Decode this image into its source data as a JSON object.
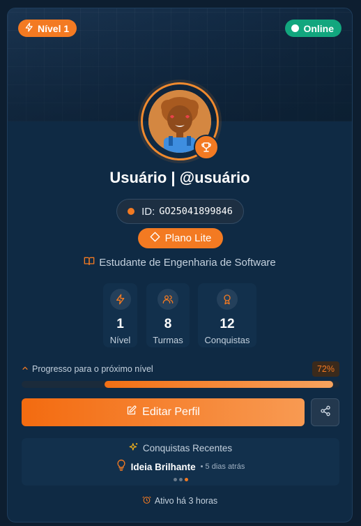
{
  "badges": {
    "level": "Nível 1",
    "status": "Online"
  },
  "profile": {
    "name": "Usuário | @usuário",
    "id_label": "ID:",
    "id_value": "GO25041899846",
    "plan": "Plano Lite",
    "course": "Estudante de Engenharia de Software"
  },
  "stats": [
    {
      "value": "1",
      "label": "Nível"
    },
    {
      "value": "8",
      "label": "Turmas"
    },
    {
      "value": "12",
      "label": "Conquistas"
    }
  ],
  "progress": {
    "label": "Progresso para o próximo nível",
    "percent_text": "72%",
    "percent": 72
  },
  "actions": {
    "edit_label": "Editar Perfil"
  },
  "recent": {
    "title": "Conquistas Recentes",
    "item_name": "Ideia Brilhante",
    "item_time": "• 5 dias atrás"
  },
  "activity": "Ativo há 3 horas",
  "colors": {
    "accent": "#f37a22",
    "online": "#12a67e",
    "card": "#0f2a44"
  }
}
